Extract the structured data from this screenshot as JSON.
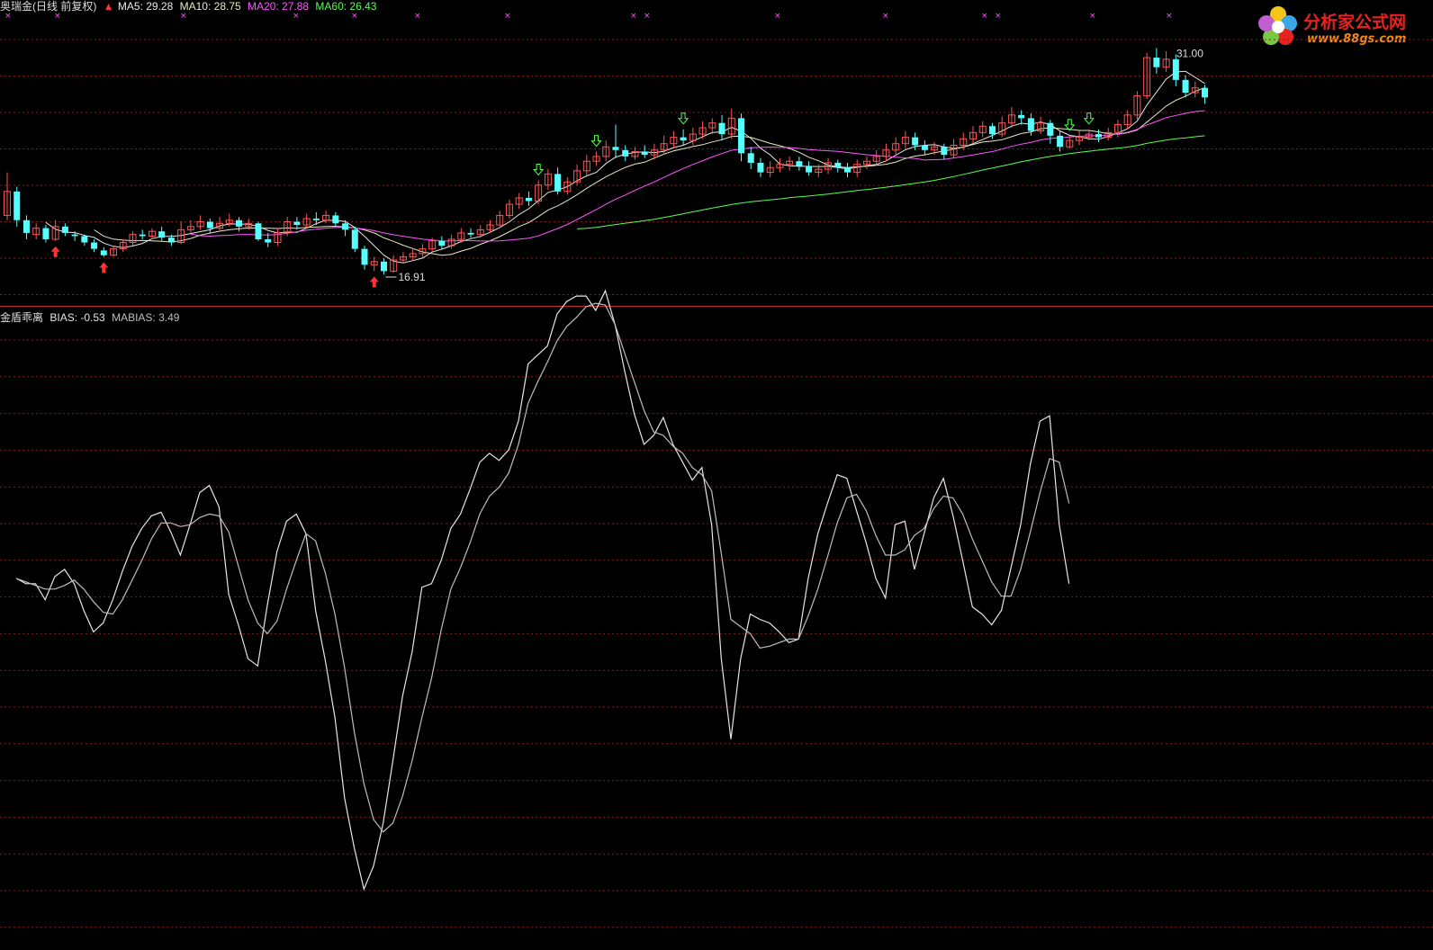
{
  "colors": {
    "background": "#000000",
    "up_candle": "#ff5555",
    "down_candle": "#55ffff",
    "ma5": "#e8e8e8",
    "ma10": "#e8e8c0",
    "ma20": "#ff55ff",
    "ma60": "#55ff55",
    "grid": "#8a1a1a",
    "divider": "#c03030",
    "bias": "#e6e6e6",
    "mabias": "#bdbdbd",
    "buy_arrow": "#ff3333",
    "sell_arrow": "#55ff55"
  },
  "header": {
    "stock_title": "奥瑞金(日线 前复权)",
    "ma5": "MA5: 29.28",
    "ma10": "MA10: 28.75",
    "ma20": "MA20: 27.88",
    "ma60": "MA60: 26.43"
  },
  "indicator_header": {
    "name": "金盾乖离",
    "bias": "BIAS: -0.53",
    "mabias": "MABIAS: 3.49"
  },
  "watermark": {
    "brand": "分析家公式网",
    "url": "www.88gs.com"
  },
  "chart_data": [
    {
      "type": "candlestick",
      "price_high_label": "31.00",
      "price_low_label": "16.91",
      "ylim": [
        15.5,
        33.0
      ],
      "candles": [
        [
          20.5,
          22.0,
          23.2,
          20.2
        ],
        [
          22.0,
          20.2,
          22.3,
          19.8
        ],
        [
          20.2,
          19.4,
          20.5,
          19.0
        ],
        [
          19.3,
          19.7,
          20.0,
          19.0
        ],
        [
          19.7,
          19.0,
          19.9,
          18.8
        ],
        [
          19.0,
          19.8,
          20.2,
          18.9
        ],
        [
          19.8,
          19.4,
          20.0,
          19.2
        ],
        [
          19.3,
          19.2,
          19.5,
          18.9
        ],
        [
          19.2,
          18.8,
          19.3,
          18.6
        ],
        [
          18.8,
          18.4,
          19.0,
          18.2
        ],
        [
          18.3,
          18.0,
          18.5,
          17.9
        ],
        [
          18.0,
          18.4,
          18.6,
          17.9
        ],
        [
          18.4,
          18.8,
          19.0,
          18.2
        ],
        [
          18.8,
          19.3,
          19.5,
          18.6
        ],
        [
          19.3,
          19.2,
          19.6,
          19.0
        ],
        [
          19.2,
          19.5,
          19.7,
          19.0
        ],
        [
          19.5,
          19.1,
          19.8,
          18.9
        ],
        [
          19.1,
          18.8,
          19.3,
          18.6
        ],
        [
          18.8,
          19.6,
          20.1,
          18.7
        ],
        [
          19.6,
          19.8,
          20.2,
          19.4
        ],
        [
          19.8,
          20.1,
          20.5,
          19.6
        ],
        [
          20.1,
          19.7,
          20.3,
          19.4
        ],
        [
          19.7,
          20.0,
          20.4,
          19.5
        ],
        [
          20.0,
          20.2,
          20.6,
          19.8
        ],
        [
          20.2,
          19.8,
          20.4,
          19.5
        ],
        [
          19.8,
          20.0,
          20.3,
          19.6
        ],
        [
          20.0,
          19.0,
          20.1,
          18.9
        ],
        [
          19.0,
          18.8,
          19.4,
          18.5
        ],
        [
          18.8,
          19.4,
          19.7,
          18.6
        ],
        [
          19.4,
          20.1,
          20.4,
          19.2
        ],
        [
          20.1,
          19.9,
          20.4,
          19.6
        ],
        [
          19.9,
          20.3,
          20.6,
          19.7
        ],
        [
          20.3,
          20.2,
          20.7,
          19.9
        ],
        [
          20.2,
          20.5,
          20.8,
          20.0
        ],
        [
          20.5,
          20.0,
          20.7,
          19.8
        ],
        [
          20.0,
          19.6,
          20.2,
          19.2
        ],
        [
          19.6,
          18.4,
          19.8,
          18.2
        ],
        [
          18.4,
          17.4,
          18.6,
          17.1
        ],
        [
          17.4,
          17.6,
          17.9,
          17.0
        ],
        [
          17.6,
          17.0,
          17.8,
          16.8
        ],
        [
          17.0,
          17.7,
          18.0,
          16.9
        ],
        [
          17.7,
          17.9,
          18.2,
          17.5
        ],
        [
          17.9,
          18.1,
          18.4,
          17.7
        ],
        [
          18.1,
          18.4,
          18.7,
          17.9
        ],
        [
          18.4,
          18.9,
          19.1,
          18.2
        ],
        [
          18.9,
          18.6,
          19.2,
          18.4
        ],
        [
          18.6,
          19.0,
          19.3,
          18.4
        ],
        [
          19.0,
          19.4,
          19.7,
          18.8
        ],
        [
          19.4,
          19.3,
          19.7,
          19.1
        ],
        [
          19.3,
          19.6,
          19.9,
          19.1
        ],
        [
          19.6,
          19.9,
          20.2,
          19.4
        ],
        [
          19.9,
          20.5,
          20.8,
          19.7
        ],
        [
          20.5,
          21.2,
          21.5,
          20.3
        ],
        [
          21.2,
          21.6,
          21.9,
          20.9
        ],
        [
          21.6,
          21.4,
          22.0,
          21.1
        ],
        [
          21.4,
          22.4,
          22.7,
          21.2
        ],
        [
          22.4,
          23.1,
          23.4,
          22.1
        ],
        [
          23.1,
          22.0,
          23.5,
          21.8
        ],
        [
          22.0,
          22.6,
          22.9,
          21.8
        ],
        [
          22.6,
          23.3,
          23.7,
          22.4
        ],
        [
          23.3,
          23.9,
          24.3,
          23.0
        ],
        [
          23.9,
          24.2,
          24.5,
          23.6
        ],
        [
          24.2,
          24.8,
          25.2,
          23.9
        ],
        [
          24.8,
          24.6,
          26.2,
          24.1
        ],
        [
          24.6,
          24.2,
          24.9,
          23.9
        ],
        [
          24.2,
          24.5,
          24.8,
          24.0
        ],
        [
          24.5,
          24.3,
          24.9,
          24.1
        ],
        [
          24.3,
          24.6,
          25.0,
          24.0
        ],
        [
          24.6,
          25.0,
          25.5,
          24.3
        ],
        [
          25.0,
          25.4,
          25.8,
          24.7
        ],
        [
          25.4,
          25.2,
          25.9,
          24.9
        ],
        [
          25.2,
          25.6,
          26.0,
          24.9
        ],
        [
          25.6,
          26.0,
          26.4,
          25.3
        ],
        [
          26.0,
          26.3,
          26.6,
          25.6
        ],
        [
          26.3,
          25.6,
          26.8,
          25.2
        ],
        [
          25.6,
          26.6,
          27.2,
          25.3
        ],
        [
          26.6,
          24.4,
          26.9,
          23.9
        ],
        [
          24.4,
          23.8,
          24.8,
          23.4
        ],
        [
          23.8,
          23.2,
          24.1,
          22.9
        ],
        [
          23.2,
          23.5,
          23.9,
          22.9
        ],
        [
          23.5,
          23.7,
          24.1,
          23.2
        ],
        [
          23.7,
          23.9,
          24.2,
          23.3
        ],
        [
          23.9,
          23.6,
          24.2,
          23.3
        ],
        [
          23.6,
          23.2,
          23.9,
          23.0
        ],
        [
          23.2,
          23.4,
          23.7,
          22.9
        ],
        [
          23.4,
          23.8,
          24.1,
          23.1
        ],
        [
          23.8,
          23.5,
          24.0,
          23.2
        ],
        [
          23.5,
          23.2,
          23.8,
          22.9
        ],
        [
          23.2,
          23.7,
          24.0,
          22.9
        ],
        [
          23.7,
          23.9,
          24.2,
          23.4
        ],
        [
          23.9,
          24.2,
          24.6,
          23.6
        ],
        [
          24.2,
          24.6,
          25.0,
          23.9
        ],
        [
          24.6,
          25.0,
          25.4,
          24.3
        ],
        [
          25.0,
          25.4,
          25.8,
          24.7
        ],
        [
          25.4,
          24.9,
          25.7,
          24.6
        ],
        [
          24.9,
          24.6,
          25.2,
          24.3
        ],
        [
          24.6,
          24.8,
          25.1,
          24.3
        ],
        [
          24.8,
          24.3,
          25.0,
          24.0
        ],
        [
          24.3,
          24.9,
          25.3,
          24.1
        ],
        [
          24.9,
          25.3,
          25.7,
          24.6
        ],
        [
          25.3,
          25.7,
          26.1,
          25.0
        ],
        [
          25.7,
          26.1,
          26.4,
          25.4
        ],
        [
          26.1,
          25.6,
          26.3,
          25.3
        ],
        [
          25.6,
          26.3,
          26.7,
          25.4
        ],
        [
          26.3,
          26.8,
          27.3,
          26.0
        ],
        [
          26.8,
          26.6,
          27.1,
          26.2
        ],
        [
          26.6,
          25.8,
          26.9,
          25.5
        ],
        [
          25.8,
          26.3,
          26.7,
          25.6
        ],
        [
          26.3,
          25.5,
          26.5,
          25.0
        ],
        [
          25.5,
          24.8,
          25.8,
          24.5
        ],
        [
          24.8,
          25.2,
          25.5,
          24.7
        ],
        [
          25.2,
          25.4,
          25.8,
          24.9
        ],
        [
          25.4,
          25.6,
          25.9,
          25.2
        ],
        [
          25.6,
          25.4,
          25.9,
          25.1
        ],
        [
          25.4,
          25.7,
          26.0,
          25.2
        ],
        [
          25.7,
          26.2,
          26.5,
          25.4
        ],
        [
          26.2,
          26.8,
          27.1,
          25.9
        ],
        [
          26.8,
          28.0,
          28.3,
          26.5
        ],
        [
          28.0,
          30.4,
          30.7,
          27.8
        ],
        [
          30.4,
          29.8,
          31.0,
          29.4
        ],
        [
          29.8,
          30.3,
          30.8,
          29.5
        ],
        [
          30.3,
          29.0,
          30.6,
          28.6
        ],
        [
          29.0,
          28.2,
          29.3,
          27.9
        ],
        [
          28.2,
          28.5,
          28.9,
          27.9
        ],
        [
          28.5,
          27.9,
          28.7,
          27.5
        ]
      ],
      "ma_window_start": {
        "ma5": 4,
        "ma10": 9,
        "ma20": 19,
        "ma60": 59
      },
      "buy_signal_index": [
        5,
        10,
        38
      ],
      "sell_signal_index": [
        55,
        61,
        70,
        110,
        112
      ]
    },
    {
      "type": "line",
      "ylim": [
        -20,
        15
      ],
      "series": [
        {
          "name": "BIAS",
          "values": [
            0.0,
            -0.3,
            -0.3,
            -1.2,
            0.1,
            0.5,
            -0.3,
            -1.8,
            -3.0,
            -2.5,
            -1.2,
            0.4,
            1.8,
            2.8,
            3.5,
            3.7,
            2.6,
            1.3,
            3.0,
            4.8,
            5.2,
            4.0,
            -0.9,
            -2.6,
            -4.5,
            -4.9,
            -1.5,
            1.5,
            3.2,
            3.6,
            2.5,
            -1.8,
            -4.6,
            -7.8,
            -12.3,
            -15.1,
            -17.4,
            -16.1,
            -13.7,
            -10.2,
            -6.6,
            -4.1,
            -0.5,
            -0.3,
            1.0,
            2.8,
            3.6,
            5.0,
            6.5,
            7.0,
            6.6,
            7.2,
            8.8,
            12.0,
            12.5,
            13.0,
            14.8,
            15.5,
            15.8,
            15.8,
            15.0,
            16.1,
            14.2,
            11.6,
            9.2,
            7.5,
            8.0,
            9.0,
            7.5,
            6.5,
            5.5,
            6.2,
            3.0,
            -4.5,
            -9.0,
            -4.5,
            -2.0,
            -2.3,
            -2.5,
            -3.0,
            -3.6,
            -3.4,
            0.0,
            2.5,
            4.2,
            5.8,
            5.6,
            3.8,
            2.0,
            0.0,
            -1.1,
            3.0,
            3.2,
            0.5,
            2.5,
            4.5,
            5.6,
            3.5,
            1.0,
            -1.6,
            -2.0,
            -2.6,
            -1.8,
            0.6,
            3.0,
            6.4,
            8.8,
            9.1,
            3.0,
            -0.3
          ]
        },
        {
          "name": "MABIAS",
          "values": [
            0.0,
            -0.2,
            -0.4,
            -0.6,
            -0.6,
            -0.4,
            -0.1,
            -0.6,
            -1.3,
            -1.9,
            -2.0,
            -1.2,
            -0.1,
            1.0,
            2.2,
            3.1,
            3.1,
            2.9,
            3.0,
            3.4,
            3.6,
            3.5,
            2.6,
            0.7,
            -1.2,
            -2.5,
            -3.1,
            -2.4,
            -0.6,
            1.0,
            2.5,
            2.1,
            0.3,
            -2.0,
            -5.0,
            -8.6,
            -11.5,
            -13.5,
            -14.2,
            -13.7,
            -12.2,
            -10.2,
            -7.8,
            -5.6,
            -2.9,
            -0.6,
            0.6,
            2.0,
            3.6,
            4.6,
            5.1,
            5.9,
            7.5,
            9.8,
            11.0,
            12.1,
            13.3,
            14.1,
            14.6,
            15.2,
            15.4,
            15.3,
            14.2,
            12.6,
            11.0,
            9.4,
            8.2,
            8.0,
            7.4,
            7.0,
            6.2,
            5.8,
            4.9,
            1.4,
            -2.3,
            -2.7,
            -3.1,
            -3.9,
            -3.8,
            -3.6,
            -3.4,
            -3.4,
            -2.1,
            -0.6,
            1.2,
            3.1,
            4.5,
            4.7,
            3.8,
            2.4,
            1.3,
            1.3,
            1.6,
            2.4,
            2.8,
            3.9,
            4.6,
            4.5,
            3.6,
            2.2,
            1.0,
            -0.2,
            -1.0,
            -1.0,
            0.5,
            2.6,
            4.8,
            6.7,
            6.5,
            4.2
          ]
        }
      ]
    }
  ]
}
